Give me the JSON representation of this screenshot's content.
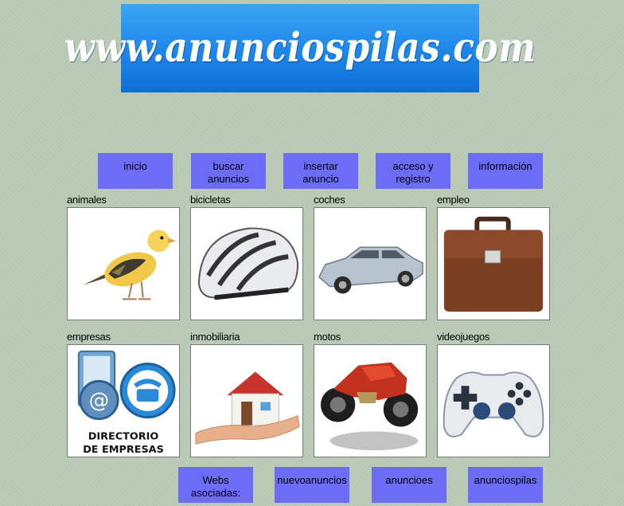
{
  "header": {
    "logo_text": "www.anunciospilas.com"
  },
  "nav": {
    "inicio": "inicio",
    "buscar_line1": "buscar",
    "buscar_line2": "anuncios",
    "insertar_line1": "insertar",
    "insertar_line2": "anuncio",
    "acceso_line1": "acceso y",
    "acceso_line2": "registro",
    "informacion": "información"
  },
  "categories": [
    {
      "label": "animales",
      "icon": "bird-icon"
    },
    {
      "label": "bicicletas",
      "icon": "helmet-icon"
    },
    {
      "label": "coches",
      "icon": "car-icon"
    },
    {
      "label": "empleo",
      "icon": "briefcase-icon"
    },
    {
      "label": "empresas",
      "icon": "directory-icon",
      "image_text_line1": "DIRECTORIO",
      "image_text_line2": "DE EMPRESAS"
    },
    {
      "label": "inmobiliaria",
      "icon": "house-in-hand-icon"
    },
    {
      "label": "motos",
      "icon": "motorcycle-icon"
    },
    {
      "label": "videojuegos",
      "icon": "gamepad-icon"
    }
  ],
  "footer_links": {
    "webs_line1": "Webs",
    "webs_line2": "asociadas:",
    "nuevoanuncios": "nuevoanuncios",
    "anuncioes": "anuncioes",
    "anunciospilas": "anunciospilas"
  },
  "colors": {
    "button": "#6c6cf7",
    "banner": "#1e85e8",
    "background": "#b9c9b4"
  }
}
